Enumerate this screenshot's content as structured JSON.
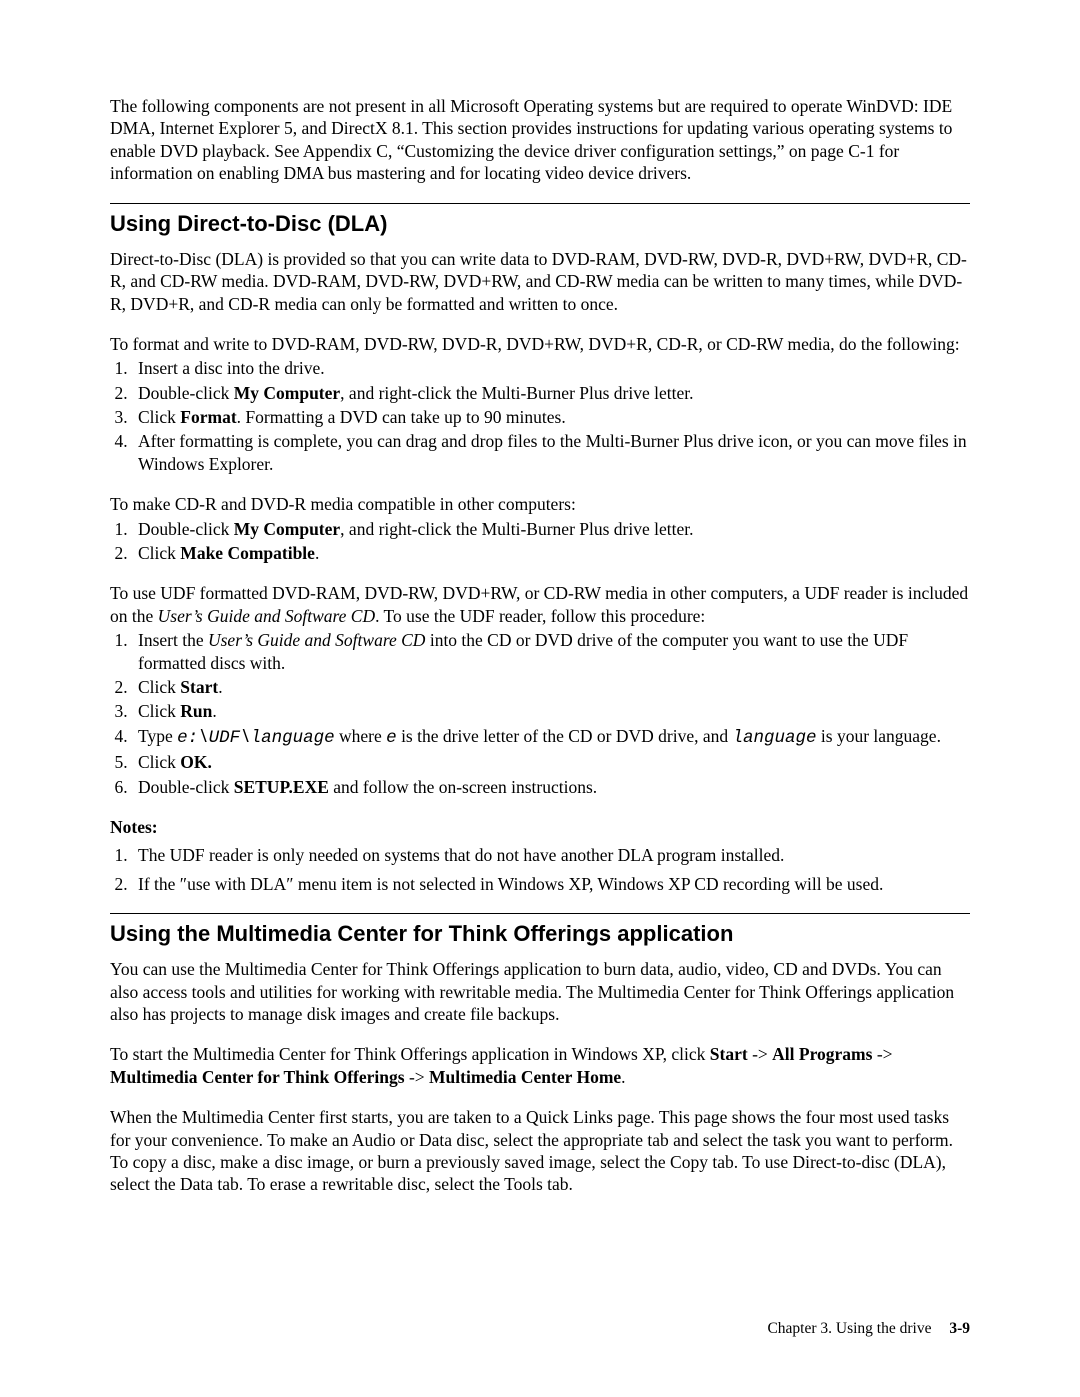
{
  "intro": "The following components are not present in all Microsoft Operating systems but are required to operate WinDVD: IDE DMA, Internet Explorer 5, and DirectX 8.1. This section provides instructions for updating various operating systems to enable DVD playback. See Appendix C, “Customizing the device driver configuration settings,” on page C-1 for information on enabling DMA bus mastering and for locating video device drivers.",
  "dla": {
    "heading": "Using Direct-to-Disc (DLA)",
    "p1": "Direct-to-Disc (DLA) is provided so that you can write data to DVD-RAM, DVD-RW, DVD-R, DVD+RW, DVD+R, CD-R, and CD-RW media. DVD-RAM, DVD-RW, DVD+RW, and CD-RW media can be written to many times, while DVD-R, DVD+R, and CD-R media can only be formatted and written to once.",
    "p2": "To format and write to DVD-RAM, DVD-RW, DVD-R, DVD+RW, DVD+R, CD-R, or CD-RW media, do the following:",
    "list1": {
      "i1": "Insert a disc into the drive.",
      "i2a": "Double-click ",
      "i2b": "My Computer",
      "i2c": ", and right-click the Multi-Burner Plus drive letter.",
      "i3a": "Click ",
      "i3b": "Format",
      "i3c": ". Formatting a DVD can take up to 90 minutes.",
      "i4": "After formatting is complete, you can drag and drop files to the Multi-Burner Plus drive icon, or you can move files in Windows Explorer."
    },
    "p3": "To make CD-R and DVD-R media compatible in other computers:",
    "list2": {
      "i1a": "Double-click ",
      "i1b": "My Computer",
      "i1c": ", and right-click the Multi-Burner Plus drive letter.",
      "i2a": "Click ",
      "i2b": "Make Compatible",
      "i2c": "."
    },
    "p4a": "To use UDF formatted DVD-RAM, DVD-RW, DVD+RW, or CD-RW media in other computers, a UDF reader is included on the ",
    "p4b": "User’s Guide and Software CD",
    "p4c": ". To use the UDF reader, follow this procedure:",
    "list3": {
      "i1a": "Insert the ",
      "i1b": "User’s Guide and Software CD",
      "i1c": " into the CD or DVD drive of the computer you want to use the UDF formatted discs with.",
      "i2a": "Click ",
      "i2b": "Start",
      "i2c": ".",
      "i3a": "Click ",
      "i3b": "Run",
      "i3c": ".",
      "i4a": "Type ",
      "i4b": "e:\\UDF\\language",
      "i4c": " where ",
      "i4d": "e",
      "i4e": " is the drive letter of the CD or DVD drive, and ",
      "i4f": "language",
      "i4g": " is your language.",
      "i5a": "Click ",
      "i5b": "OK.",
      "i6a": "Double-click ",
      "i6b": "SETUP.EXE",
      "i6c": " and follow the on-screen instructions."
    },
    "notes_h": "Notes:",
    "notes": {
      "n1": "The UDF reader is only needed on systems that do not have another DLA program installed.",
      "n2": " If the ″use with DLA″ menu item is not selected in Windows XP, Windows XP CD recording will be used."
    }
  },
  "mc": {
    "heading": "Using the Multimedia Center for Think Offerings application",
    "p1": "You can use the Multimedia Center for Think Offerings application to burn data, audio, video, CD and DVDs. You can also access tools and utilities for working with rewritable media. The Multimedia Center for Think Offerings application also has projects to manage disk images and create file backups.",
    "p2a": "To start the Multimedia Center for Think Offerings application in Windows XP, click ",
    "p2b": "Start",
    "p2c": " -> ",
    "p2d": "All Programs",
    "p2e": " -> ",
    "p2f": "Multimedia Center for Think Offerings",
    "p2g": " -> ",
    "p2h": "Multimedia Center Home",
    "p2i": ".",
    "p3": "When the Multimedia Center first starts, you are taken to a Quick Links page. This page shows the four most used tasks for your convenience. To make an Audio or Data disc, select the appropriate tab and select the task you want to perform. To copy a disc, make a disc image, or burn a previously saved image, select the Copy tab. To use Direct-to-disc (DLA), select the Data tab. To erase a rewritable disc, select the Tools tab."
  },
  "footer": {
    "chapter": "Chapter 3. Using the drive",
    "page": "3-9"
  }
}
